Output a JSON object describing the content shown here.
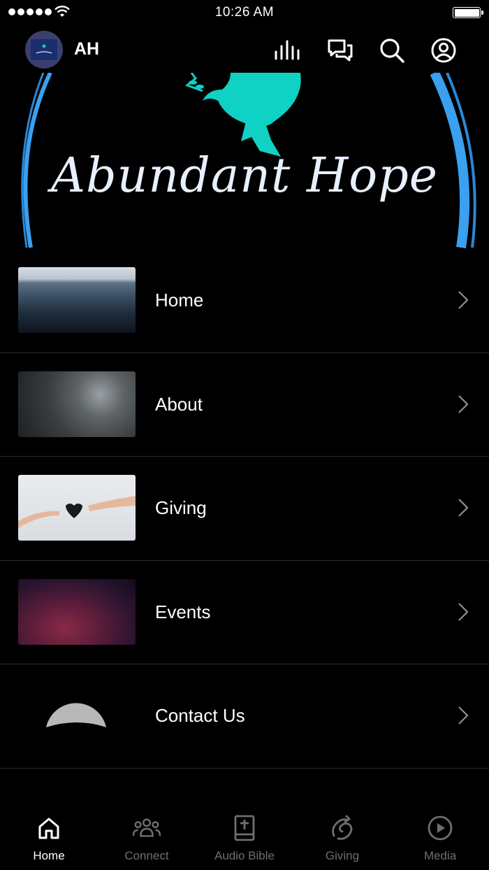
{
  "status_bar": {
    "time": "10:26 AM"
  },
  "header": {
    "initials": "AH",
    "avatar_logo_text": "Abundant Hope",
    "icons": [
      "audio-bars-icon",
      "chat-icon",
      "search-icon",
      "account-icon"
    ]
  },
  "banner": {
    "title": "Abundant Hope",
    "accent_color": "#0fd2c4",
    "ring_color": "#3aa0ef"
  },
  "menu": {
    "items": [
      {
        "label": "Home"
      },
      {
        "label": "About"
      },
      {
        "label": "Giving"
      },
      {
        "label": "Events"
      },
      {
        "label": "Contact Us"
      }
    ]
  },
  "tabbar": {
    "active": "Home",
    "tabs": [
      {
        "label": "Home",
        "icon": "home-icon"
      },
      {
        "label": "Connect",
        "icon": "people-icon"
      },
      {
        "label": "Audio Bible",
        "icon": "bible-icon"
      },
      {
        "label": "Giving",
        "icon": "giving-icon"
      },
      {
        "label": "Media",
        "icon": "play-icon"
      }
    ]
  }
}
